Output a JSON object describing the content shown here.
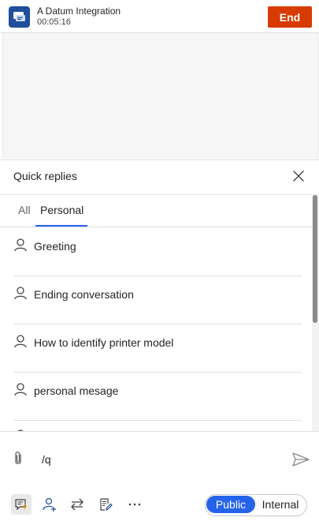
{
  "header": {
    "title": "A Datum Integration",
    "timer": "00:05:16",
    "end_label": "End",
    "app_icon": "chat-bubbles-icon"
  },
  "quick_replies": {
    "title": "Quick replies",
    "tabs": [
      {
        "label": "All",
        "selected": false
      },
      {
        "label": "Personal",
        "selected": true
      }
    ],
    "items": [
      {
        "label": "Greeting",
        "icon": "person-icon"
      },
      {
        "label": "Ending conversation",
        "icon": "person-icon"
      },
      {
        "label": "How to identify printer model",
        "icon": "person-icon"
      },
      {
        "label": "personal mesage",
        "icon": "person-icon"
      }
    ]
  },
  "composer": {
    "input_value": "/q",
    "toolbar_icons": [
      "quick-replies-icon",
      "consult-icon",
      "transfer-icon",
      "notes-icon",
      "more-icon"
    ],
    "visibility": {
      "public_label": "Public",
      "internal_label": "Internal",
      "selected": "Public"
    }
  },
  "colors": {
    "end_button": "#d83b01",
    "accent": "#2563eb",
    "app_icon_bg": "#1f4e9b"
  }
}
